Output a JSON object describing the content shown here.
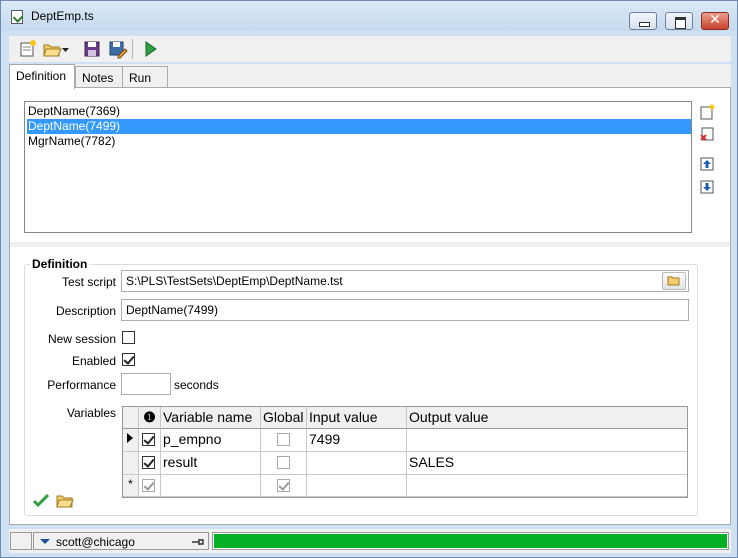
{
  "window": {
    "title": "DeptEmp.ts"
  },
  "toolbar": {
    "buttons": [
      "new-icon",
      "open-icon",
      "save-icon",
      "save-as-icon",
      "run-icon"
    ]
  },
  "tabs": [
    {
      "label": "Definition",
      "active": true
    },
    {
      "label": "Notes",
      "active": false
    },
    {
      "label": "Run",
      "active": false
    }
  ],
  "tests": [
    {
      "label": "DeptName(7369)",
      "selected": false
    },
    {
      "label": "DeptName(7499)",
      "selected": true
    },
    {
      "label": "MgrName(7782)",
      "selected": false
    }
  ],
  "definition": {
    "group_title": "Definition",
    "test_script_label": "Test script",
    "test_script_value": "S:\\PLS\\TestSets\\DeptEmp\\DeptName.tst",
    "description_label": "Description",
    "description_value": "DeptName(7499)",
    "new_session_label": "New session",
    "new_session_checked": false,
    "enabled_label": "Enabled",
    "enabled_checked": true,
    "performance_label": "Performance",
    "performance_value": "",
    "performance_unit": "seconds",
    "variables_label": "Variables"
  },
  "variables_grid": {
    "columns": [
      "Variable name",
      "Global",
      "Input value",
      "Output value"
    ],
    "rows": [
      {
        "indicator": "current",
        "checked": true,
        "name": "p_empno",
        "global": false,
        "input": "7499",
        "output": ""
      },
      {
        "indicator": "",
        "checked": true,
        "name": "result",
        "global": false,
        "input": "",
        "output": "SALES"
      }
    ],
    "new_row_indicator": "*"
  },
  "statusbar": {
    "connection": "scott@chicago",
    "progress_fraction": 1.0,
    "progress_color": "#06b025"
  },
  "colors": {
    "selection": "#3399ff",
    "accent_green": "#2e9e3e"
  }
}
